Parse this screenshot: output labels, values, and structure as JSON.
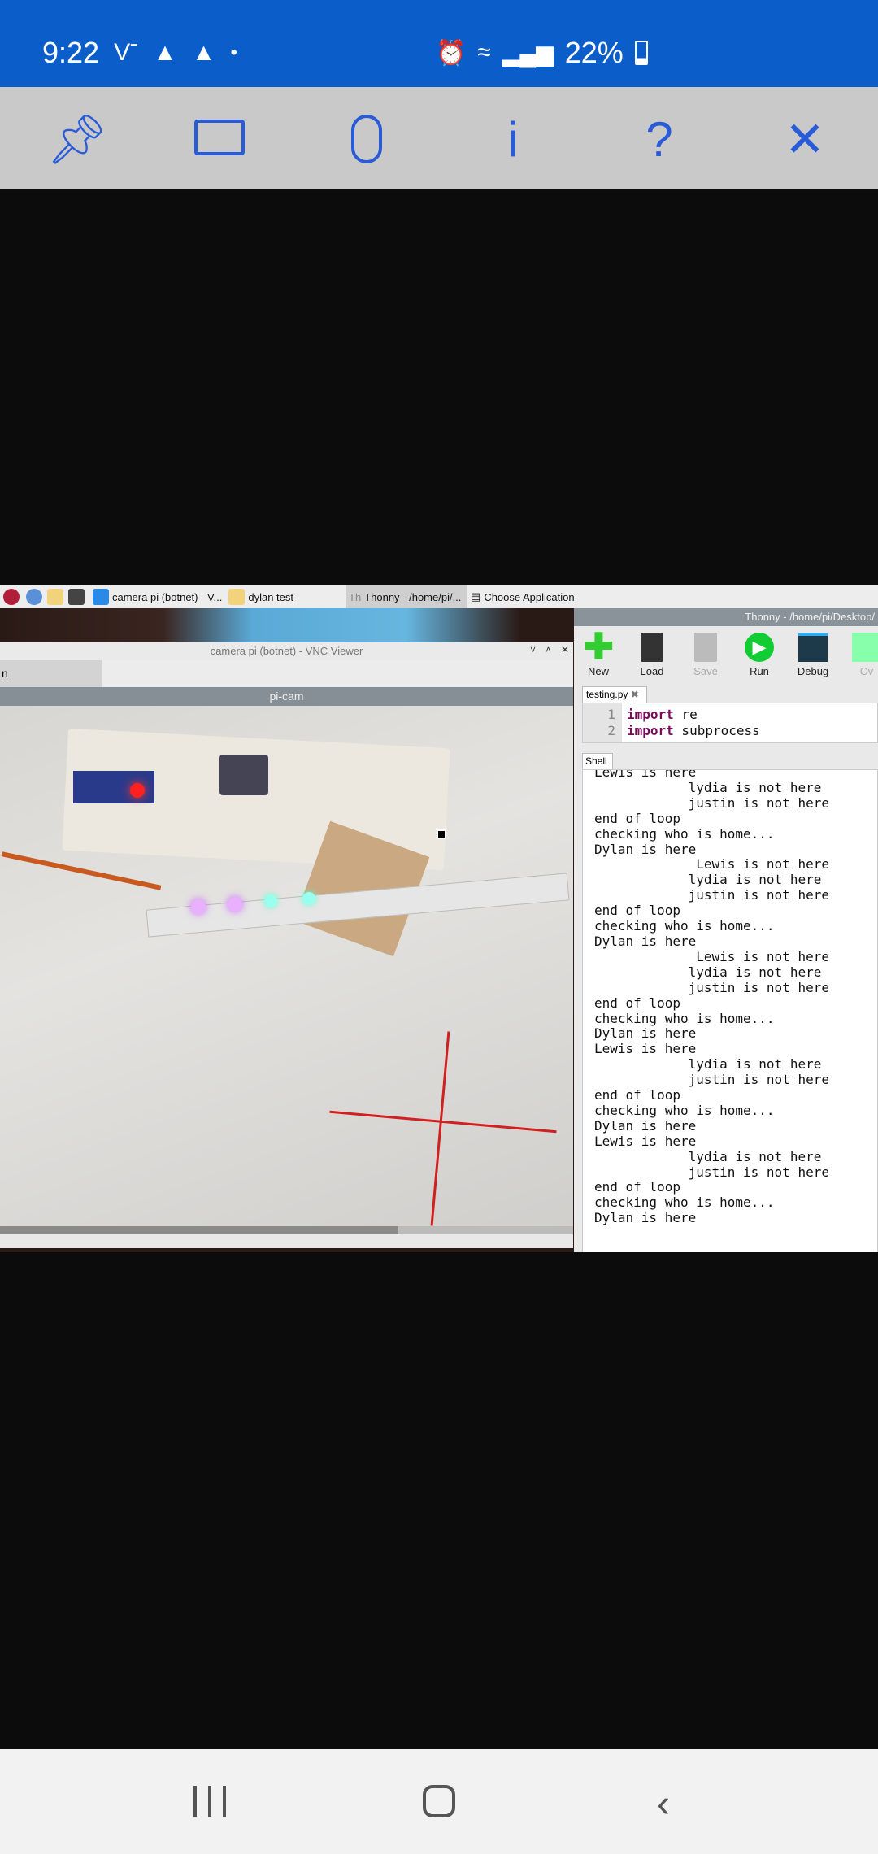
{
  "status_bar": {
    "time": "9:22",
    "battery": "22%",
    "icons": [
      "vnc-icon",
      "drive-icon",
      "drive-icon",
      "dot-icon",
      "alarm-icon",
      "wifi-icon",
      "signal-icon",
      "battery-icon"
    ]
  },
  "vnc_toolbar": {
    "buttons": [
      "pin-icon",
      "keyboard-icon",
      "mouse-icon",
      "info-icon",
      "help-icon",
      "close-icon"
    ]
  },
  "taskbar": {
    "items": [
      "camera pi (botnet) - V...",
      "dylan test",
      "Thonny  -  /home/pi/...",
      "Choose Application"
    ]
  },
  "vnc_window": {
    "title": "camera pi (botnet) - VNC Viewer",
    "tab": "n",
    "panel_title": "pi-cam"
  },
  "thonny": {
    "title": "Thonny  -  /home/pi/Desktop/",
    "toolbar": [
      {
        "label": "New"
      },
      {
        "label": "Load"
      },
      {
        "label": "Save"
      },
      {
        "label": "Run"
      },
      {
        "label": "Debug"
      },
      {
        "label": "Ov"
      }
    ],
    "editor_tab": "testing.py",
    "code": [
      {
        "n": "1",
        "kw": "import",
        "rest": " re"
      },
      {
        "n": "2",
        "kw": "import",
        "rest": " subprocess"
      }
    ],
    "shell_tab": "Shell",
    "shell_lines": [
      "Lewis is here",
      "            lydia is not here",
      "            justin is not here",
      "end of loop",
      "checking who is home...",
      "Dylan is here",
      "             Lewis is not here",
      "            lydia is not here",
      "            justin is not here",
      "end of loop",
      "checking who is home...",
      "Dylan is here",
      "             Lewis is not here",
      "            lydia is not here",
      "            justin is not here",
      "end of loop",
      "checking who is home...",
      "Dylan is here",
      "Lewis is here",
      "            lydia is not here",
      "            justin is not here",
      "end of loop",
      "checking who is home...",
      "Dylan is here",
      "Lewis is here",
      "            lydia is not here",
      "            justin is not here",
      "end of loop",
      "checking who is home...",
      "Dylan is here"
    ]
  },
  "nav_bar": {
    "buttons": [
      "recents-icon",
      "home-icon",
      "back-icon"
    ]
  }
}
